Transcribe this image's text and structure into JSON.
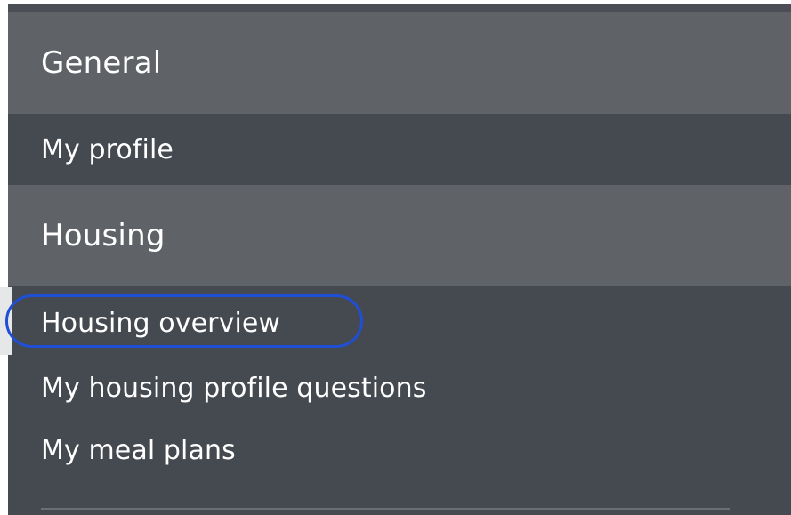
{
  "sidebar": {
    "sections": [
      {
        "title": "General",
        "items": [
          {
            "label": "My profile"
          }
        ]
      },
      {
        "title": "Housing",
        "items": [
          {
            "label": "Housing overview",
            "active": true,
            "focused": true
          },
          {
            "label": "My housing profile questions"
          },
          {
            "label": "My meal plans"
          }
        ]
      }
    ]
  },
  "colors": {
    "panel_background": "#454950",
    "section_header_background": "#5f6267",
    "text": "#ffffff",
    "focus_ring": "#1e4fd6",
    "active_marker": "#e6e7e9"
  }
}
